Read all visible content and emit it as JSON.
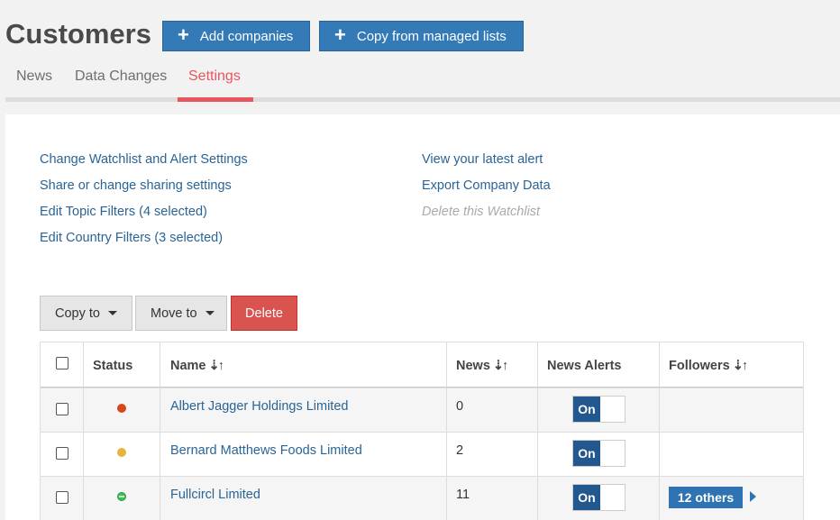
{
  "header": {
    "title": "Customers",
    "add_companies_label": "Add companies",
    "copy_managed_label": "Copy from managed lists"
  },
  "tabs": [
    {
      "label": "News"
    },
    {
      "label": "Data Changes"
    },
    {
      "label": "Settings",
      "active": true
    }
  ],
  "links": {
    "left": [
      "Change Watchlist and Alert Settings",
      "Share or change sharing settings",
      "Edit Topic Filters (4 selected)",
      "Edit Country Filters (3 selected)"
    ],
    "right": [
      "View your latest alert",
      "Export Company Data",
      "Delete this Watchlist"
    ]
  },
  "actions": {
    "copy_to": "Copy to",
    "move_to": "Move to",
    "delete": "Delete"
  },
  "table": {
    "headers": {
      "status": "Status",
      "name": "Name",
      "news": "News",
      "news_alerts": "News Alerts",
      "followers": "Followers",
      "sort_icon": "⇣↑"
    },
    "rows": [
      {
        "status": "red",
        "name": "Albert Jagger Holdings Limited",
        "news": "0",
        "alert": "On",
        "followers": ""
      },
      {
        "status": "yellow",
        "name": "Bernard Matthews Foods Limited",
        "news": "2",
        "alert": "On",
        "followers": ""
      },
      {
        "status": "green",
        "name": "Fullcircl Limited",
        "news": "11",
        "alert": "On",
        "followers": "12 others"
      }
    ]
  },
  "colors": {
    "primary": "#337ab7",
    "accent_tab": "#e8555f",
    "danger": "#d9534f",
    "toggle_on": "#22578f"
  }
}
